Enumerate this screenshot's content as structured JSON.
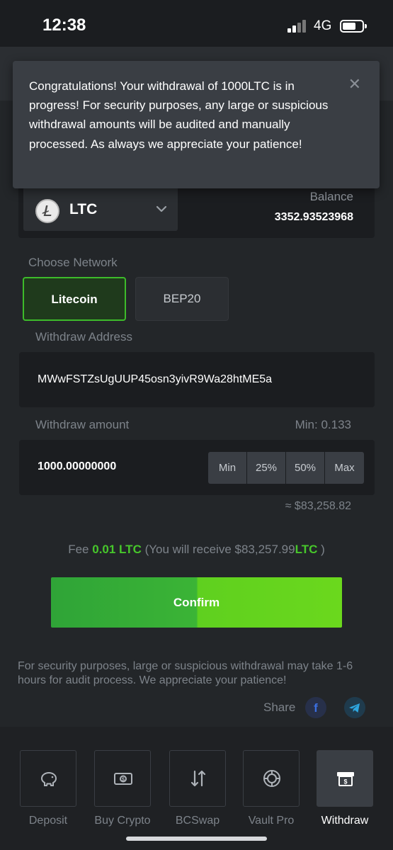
{
  "status_bar": {
    "time": "12:38",
    "network": "4G"
  },
  "toast": {
    "message": "Congratulations! Your withdrawal of 1000LTC is in progress! For security purposes, any large or suspicious withdrawal amounts will be audited and manually processed. As always we appreciate your patience!",
    "close_icon": "close-icon"
  },
  "coin": {
    "symbol": "LTC",
    "icon": "litecoin-icon",
    "balance_label": "Balance",
    "balance_value": "3352.93523968"
  },
  "network": {
    "label": "Choose Network",
    "options": [
      "Litecoin",
      "BEP20"
    ],
    "selected": "Litecoin"
  },
  "address": {
    "label": "Withdraw Address",
    "value": "MWwFSTZsUgUUP45osn3yivR9Wa28htME5a"
  },
  "amount": {
    "label": "Withdraw amount",
    "min_text": "Min: 0.133",
    "value": "1000.00000000",
    "buttons": [
      "Min",
      "25%",
      "50%",
      "Max"
    ],
    "usd_estimate": "≈ $83,258.82"
  },
  "fee": {
    "prefix": "Fee ",
    "amount": "0.01 LTC",
    "middle": " (You will receive $83,257.99",
    "currency": "LTC",
    "suffix": " )"
  },
  "confirm_label": "Confirm",
  "notice": "For security purposes, large or suspicious withdrawal may take 1-6 hours for audit process. We appreciate your patience!",
  "share": {
    "label": "Share",
    "icons": [
      "facebook-icon",
      "telegram-icon"
    ]
  },
  "bottom_nav": {
    "items": [
      {
        "label": "Deposit",
        "icon": "piggy-bank-icon"
      },
      {
        "label": "Buy Crypto",
        "icon": "cash-icon"
      },
      {
        "label": "BCSwap",
        "icon": "swap-icon"
      },
      {
        "label": "Vault Pro",
        "icon": "vault-icon"
      },
      {
        "label": "Withdraw",
        "icon": "withdraw-icon"
      }
    ],
    "active": "Withdraw"
  },
  "colors": {
    "accent_green": "#47c72b",
    "background": "#232629",
    "card": "#1b1d20"
  }
}
